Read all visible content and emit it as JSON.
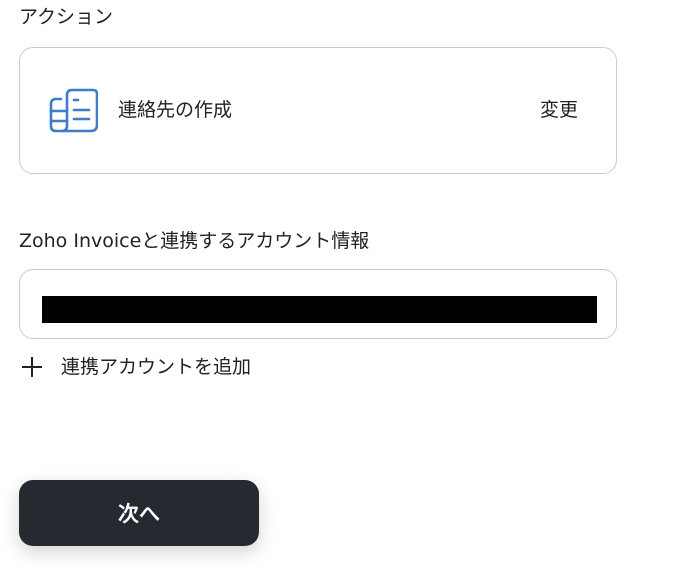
{
  "action_section": {
    "label": "アクション",
    "action_name": "連絡先の作成",
    "change_label": "変更",
    "icon": "contact-card-icon",
    "icon_color": "#3d7cc9"
  },
  "account_section": {
    "label": "Zoho Invoiceと連携するアカウント情報",
    "selected_account": "",
    "add_label": "連携アカウントを追加"
  },
  "footer": {
    "next_label": "次へ",
    "button_color": "#252a31"
  }
}
